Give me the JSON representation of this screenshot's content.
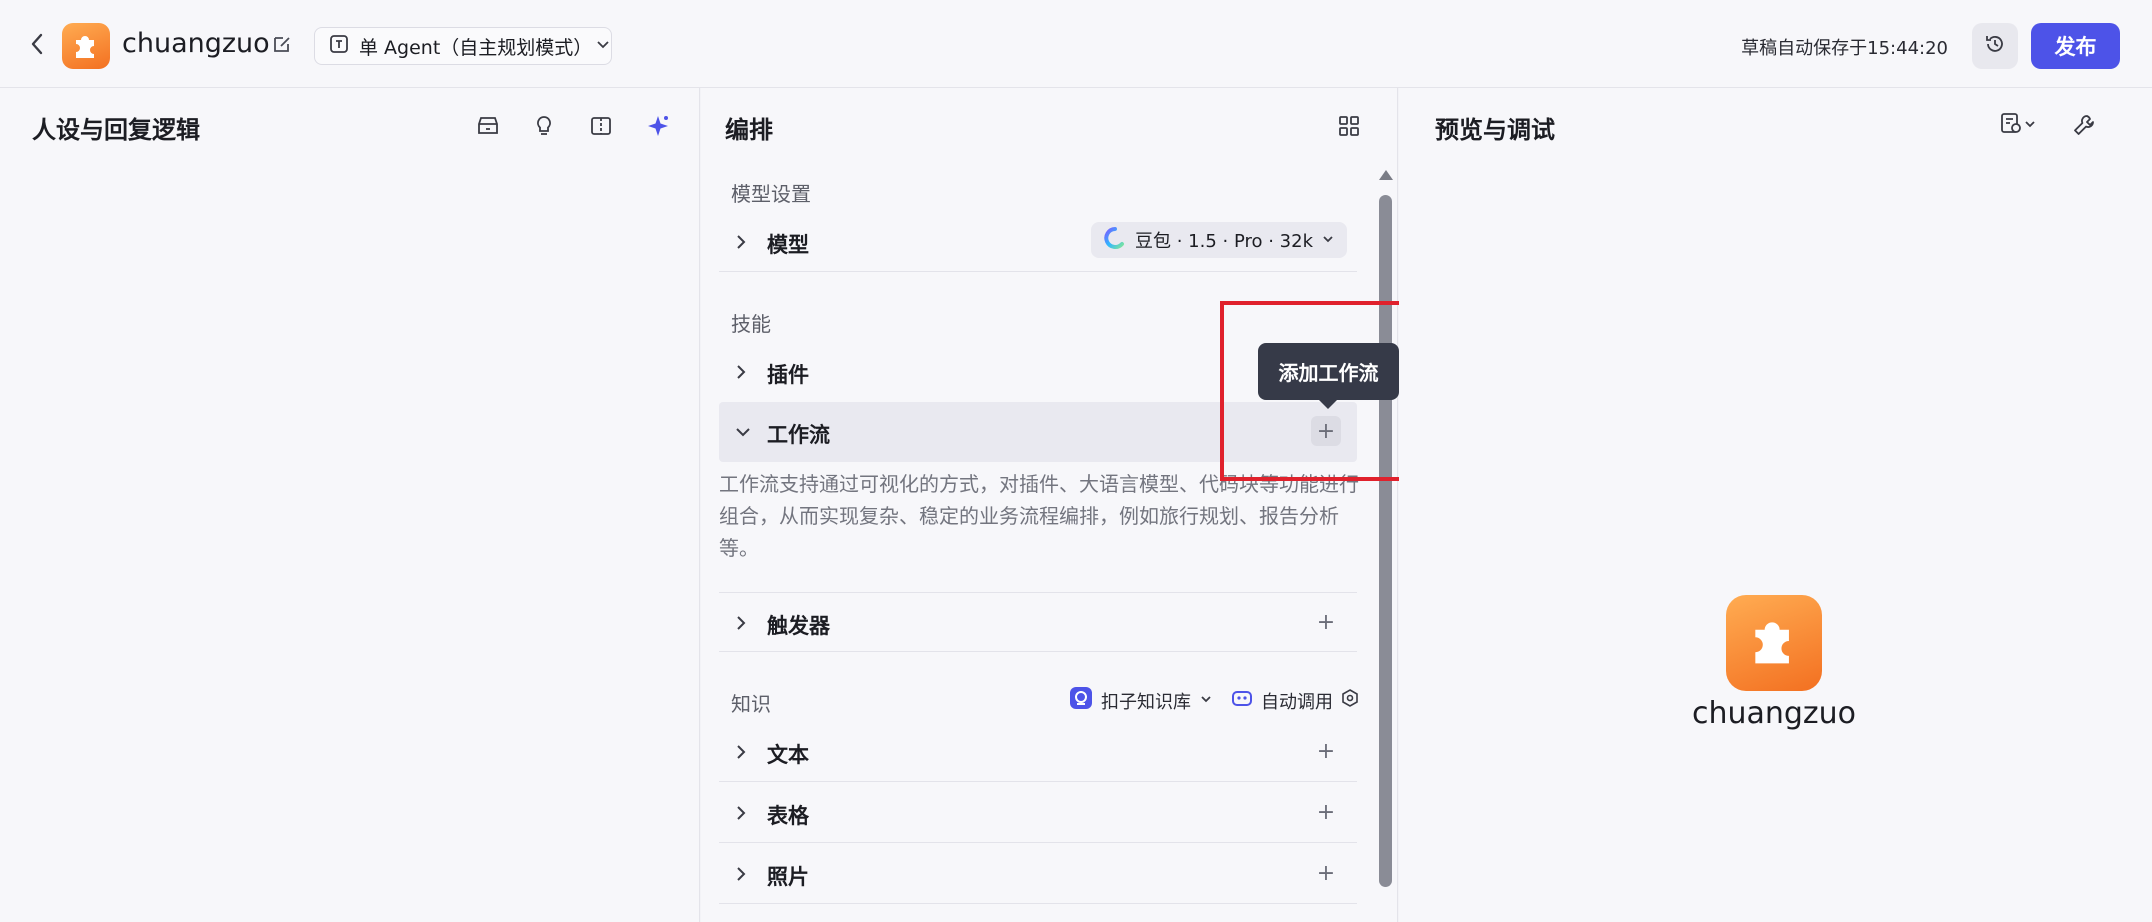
{
  "topbar": {
    "app_name": "chuangzuo",
    "mode_label": "单 Agent（自主规划模式）",
    "autosave_text": "草稿自动保存于15:44:20",
    "publish_label": "发布"
  },
  "left_panel": {
    "title": "人设与回复逻辑"
  },
  "mid_panel": {
    "title": "编排",
    "model_section_label": "模型设置",
    "model_row_label": "模型",
    "model_chip_label": "豆包 · 1.5 · Pro · 32k",
    "skills_section_label": "技能",
    "plugin_row_label": "插件",
    "workflow_row_label": "工作流",
    "workflow_description": "工作流支持通过可视化的方式，对插件、大语言模型、代码块等功能进行组合，从而实现复杂、稳定的业务流程编排，例如旅行规划、报告分析等。",
    "trigger_row_label": "触发器",
    "knowledge_section_label": "知识",
    "kb_select_label": "扣子知识库",
    "auto_call_label": "自动调用",
    "text_row_label": "文本",
    "table_row_label": "表格",
    "photo_row_label": "照片",
    "tooltip_text": "添加工作流"
  },
  "right_panel": {
    "title": "预览与调试",
    "bot_name": "chuangzuo"
  },
  "colors": {
    "accent": "#4d53e8",
    "highlight_box": "#e0212c",
    "tooltip_bg": "#363a48",
    "logo_orange": "#f37021"
  },
  "icons": [
    "back-icon",
    "app-logo-icon",
    "edit-icon",
    "agent-mode-icon",
    "chevron-down-icon",
    "history-icon",
    "store-icon",
    "lightbulb-icon",
    "compare-icon",
    "sparkle-icon",
    "layout-grid-icon",
    "chevron-right-icon",
    "plus-icon",
    "knowledge-base-icon",
    "robot-icon",
    "settings-icon",
    "debug-icon",
    "wrench-icon"
  ]
}
